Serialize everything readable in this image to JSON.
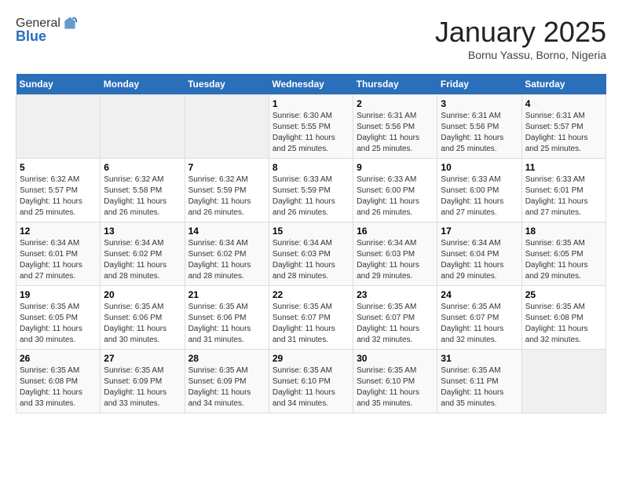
{
  "header": {
    "logo_line1": "General",
    "logo_line2": "Blue",
    "month": "January 2025",
    "location": "Bornu Yassu, Borno, Nigeria"
  },
  "weekdays": [
    "Sunday",
    "Monday",
    "Tuesday",
    "Wednesday",
    "Thursday",
    "Friday",
    "Saturday"
  ],
  "weeks": [
    [
      {
        "day": "",
        "info": ""
      },
      {
        "day": "",
        "info": ""
      },
      {
        "day": "",
        "info": ""
      },
      {
        "day": "1",
        "info": "Sunrise: 6:30 AM\nSunset: 5:55 PM\nDaylight: 11 hours\nand 25 minutes."
      },
      {
        "day": "2",
        "info": "Sunrise: 6:31 AM\nSunset: 5:56 PM\nDaylight: 11 hours\nand 25 minutes."
      },
      {
        "day": "3",
        "info": "Sunrise: 6:31 AM\nSunset: 5:56 PM\nDaylight: 11 hours\nand 25 minutes."
      },
      {
        "day": "4",
        "info": "Sunrise: 6:31 AM\nSunset: 5:57 PM\nDaylight: 11 hours\nand 25 minutes."
      }
    ],
    [
      {
        "day": "5",
        "info": "Sunrise: 6:32 AM\nSunset: 5:57 PM\nDaylight: 11 hours\nand 25 minutes."
      },
      {
        "day": "6",
        "info": "Sunrise: 6:32 AM\nSunset: 5:58 PM\nDaylight: 11 hours\nand 26 minutes."
      },
      {
        "day": "7",
        "info": "Sunrise: 6:32 AM\nSunset: 5:59 PM\nDaylight: 11 hours\nand 26 minutes."
      },
      {
        "day": "8",
        "info": "Sunrise: 6:33 AM\nSunset: 5:59 PM\nDaylight: 11 hours\nand 26 minutes."
      },
      {
        "day": "9",
        "info": "Sunrise: 6:33 AM\nSunset: 6:00 PM\nDaylight: 11 hours\nand 26 minutes."
      },
      {
        "day": "10",
        "info": "Sunrise: 6:33 AM\nSunset: 6:00 PM\nDaylight: 11 hours\nand 27 minutes."
      },
      {
        "day": "11",
        "info": "Sunrise: 6:33 AM\nSunset: 6:01 PM\nDaylight: 11 hours\nand 27 minutes."
      }
    ],
    [
      {
        "day": "12",
        "info": "Sunrise: 6:34 AM\nSunset: 6:01 PM\nDaylight: 11 hours\nand 27 minutes."
      },
      {
        "day": "13",
        "info": "Sunrise: 6:34 AM\nSunset: 6:02 PM\nDaylight: 11 hours\nand 28 minutes."
      },
      {
        "day": "14",
        "info": "Sunrise: 6:34 AM\nSunset: 6:02 PM\nDaylight: 11 hours\nand 28 minutes."
      },
      {
        "day": "15",
        "info": "Sunrise: 6:34 AM\nSunset: 6:03 PM\nDaylight: 11 hours\nand 28 minutes."
      },
      {
        "day": "16",
        "info": "Sunrise: 6:34 AM\nSunset: 6:03 PM\nDaylight: 11 hours\nand 29 minutes."
      },
      {
        "day": "17",
        "info": "Sunrise: 6:34 AM\nSunset: 6:04 PM\nDaylight: 11 hours\nand 29 minutes."
      },
      {
        "day": "18",
        "info": "Sunrise: 6:35 AM\nSunset: 6:05 PM\nDaylight: 11 hours\nand 29 minutes."
      }
    ],
    [
      {
        "day": "19",
        "info": "Sunrise: 6:35 AM\nSunset: 6:05 PM\nDaylight: 11 hours\nand 30 minutes."
      },
      {
        "day": "20",
        "info": "Sunrise: 6:35 AM\nSunset: 6:06 PM\nDaylight: 11 hours\nand 30 minutes."
      },
      {
        "day": "21",
        "info": "Sunrise: 6:35 AM\nSunset: 6:06 PM\nDaylight: 11 hours\nand 31 minutes."
      },
      {
        "day": "22",
        "info": "Sunrise: 6:35 AM\nSunset: 6:07 PM\nDaylight: 11 hours\nand 31 minutes."
      },
      {
        "day": "23",
        "info": "Sunrise: 6:35 AM\nSunset: 6:07 PM\nDaylight: 11 hours\nand 32 minutes."
      },
      {
        "day": "24",
        "info": "Sunrise: 6:35 AM\nSunset: 6:07 PM\nDaylight: 11 hours\nand 32 minutes."
      },
      {
        "day": "25",
        "info": "Sunrise: 6:35 AM\nSunset: 6:08 PM\nDaylight: 11 hours\nand 32 minutes."
      }
    ],
    [
      {
        "day": "26",
        "info": "Sunrise: 6:35 AM\nSunset: 6:08 PM\nDaylight: 11 hours\nand 33 minutes."
      },
      {
        "day": "27",
        "info": "Sunrise: 6:35 AM\nSunset: 6:09 PM\nDaylight: 11 hours\nand 33 minutes."
      },
      {
        "day": "28",
        "info": "Sunrise: 6:35 AM\nSunset: 6:09 PM\nDaylight: 11 hours\nand 34 minutes."
      },
      {
        "day": "29",
        "info": "Sunrise: 6:35 AM\nSunset: 6:10 PM\nDaylight: 11 hours\nand 34 minutes."
      },
      {
        "day": "30",
        "info": "Sunrise: 6:35 AM\nSunset: 6:10 PM\nDaylight: 11 hours\nand 35 minutes."
      },
      {
        "day": "31",
        "info": "Sunrise: 6:35 AM\nSunset: 6:11 PM\nDaylight: 11 hours\nand 35 minutes."
      },
      {
        "day": "",
        "info": ""
      }
    ]
  ]
}
